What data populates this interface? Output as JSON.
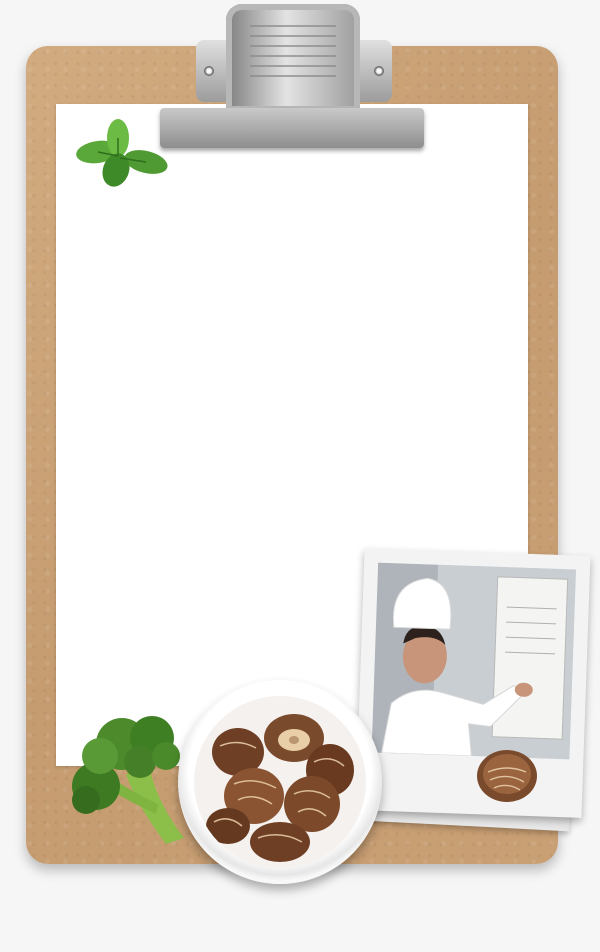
{
  "scene": {
    "colors": {
      "background": "#f6f6f6",
      "clipboard": "#c99f74",
      "paper": "#ffffff",
      "clip_metal": "#b5b5b5",
      "basil": "#5aa83a",
      "broccoli": "#4c8a2c",
      "mushroom_cap": "#7a4a2c",
      "photo_frame": "#f3f3f3",
      "chef_uniform": "#ffffff"
    },
    "icons": {
      "basil": "basil-leaves-icon",
      "broccoli": "broccoli-icon",
      "mushrooms": "shiitake-mushroom-icon",
      "clip": "clipboard-clip-icon",
      "chef": "chef-photo-icon"
    }
  }
}
